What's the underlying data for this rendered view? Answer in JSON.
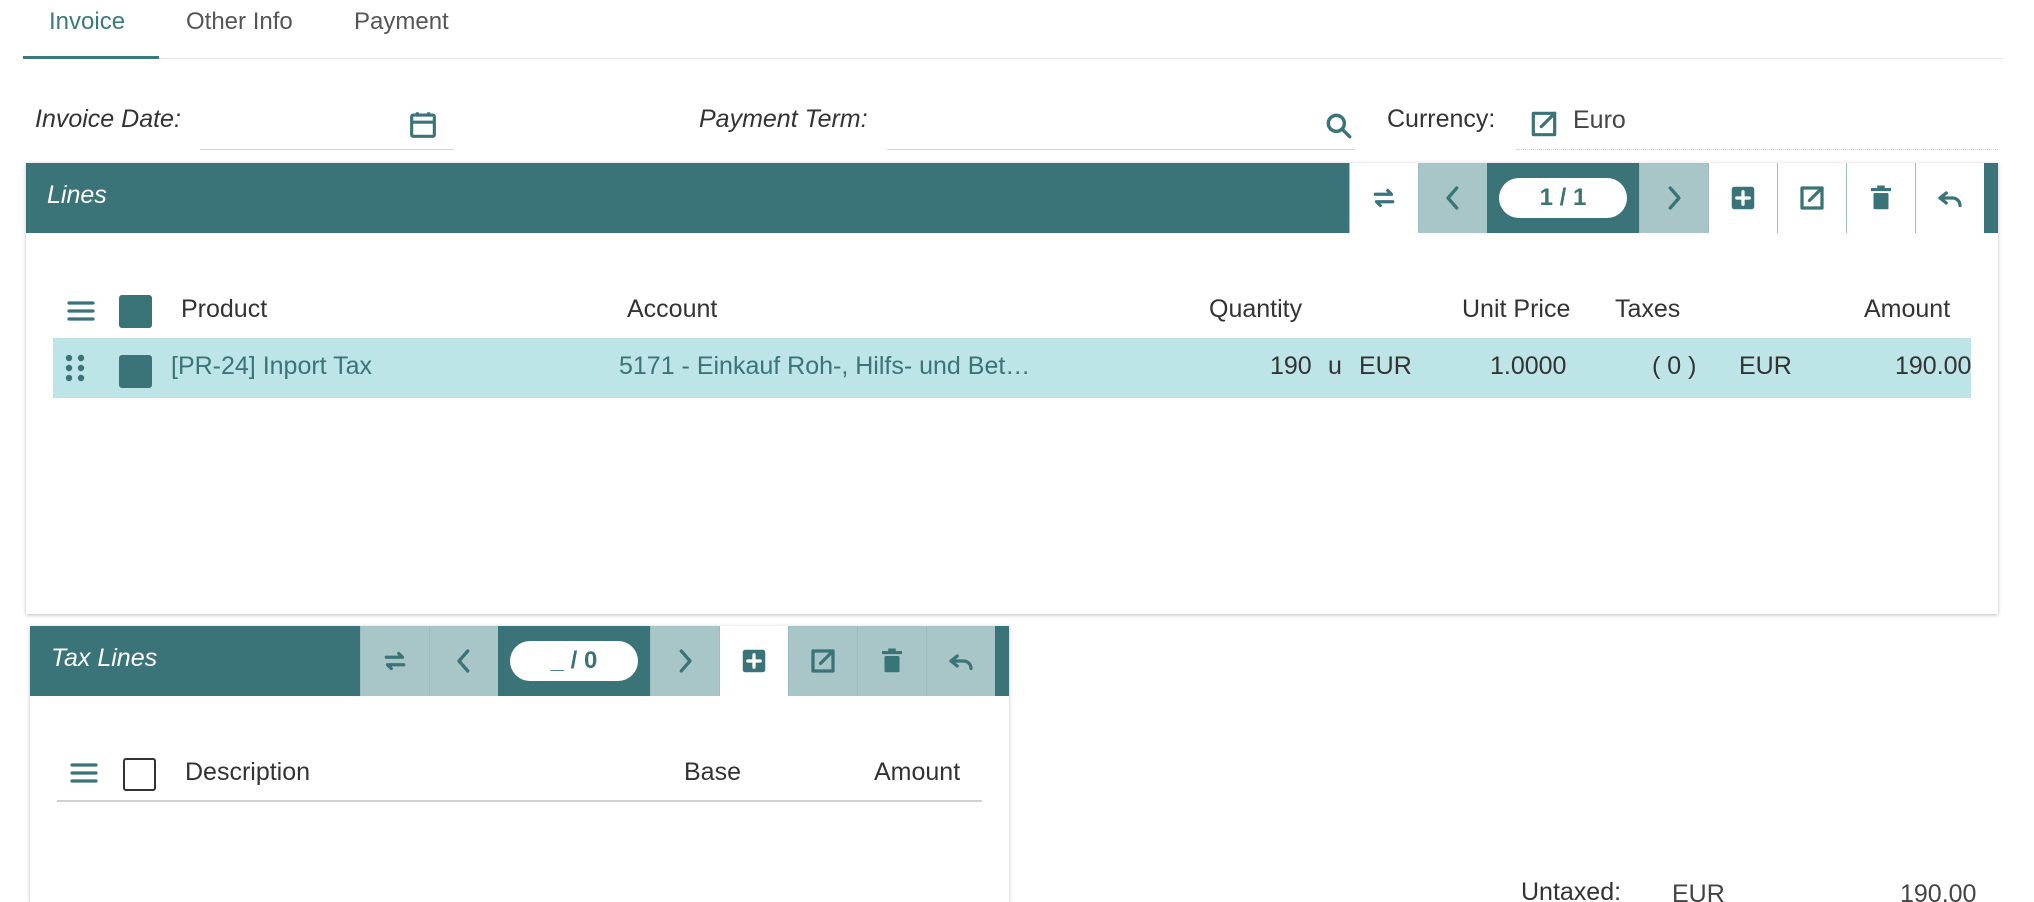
{
  "tabs": [
    {
      "label": "Invoice",
      "active": true
    },
    {
      "label": "Other Info",
      "active": false
    },
    {
      "label": "Payment",
      "active": false
    }
  ],
  "form": {
    "invoice_date_label": "Invoice Date:",
    "invoice_date_value": "",
    "payment_term_label": "Payment Term:",
    "payment_term_value": "",
    "currency_label": "Currency:",
    "currency_value": "Euro"
  },
  "lines": {
    "title": "Lines",
    "counter": "1 / 1",
    "columns": [
      "Product",
      "Account",
      "Quantity",
      "Unit Price",
      "Taxes",
      "Amount"
    ],
    "rows": [
      {
        "product": "[PR-24] Inport Tax",
        "account": "5171 - Einkauf Roh-, Hilfs- und Bet…",
        "quantity": "190",
        "unit": "u",
        "currency": "EUR",
        "unit_price": "1.0000",
        "taxes": "( 0 )",
        "amount_currency": "EUR",
        "amount": "190.00"
      }
    ]
  },
  "tax_lines": {
    "title": "Tax Lines",
    "counter": "_ / 0",
    "columns": [
      "Description",
      "Base",
      "Amount"
    ]
  },
  "totals": {
    "untaxed_label": "Untaxed:",
    "untaxed_currency": "EUR",
    "untaxed_value": "190.00"
  },
  "colors": {
    "accent": "#3a7478",
    "selected_row": "#bde4e6"
  },
  "icons": [
    "calendar-icon",
    "search-icon",
    "open-link-icon",
    "switch-view-icon",
    "chevron-left-icon",
    "chevron-right-icon",
    "add-icon",
    "edit-icon",
    "delete-icon",
    "undo-icon",
    "drag-handle-icon",
    "menu-icon"
  ]
}
